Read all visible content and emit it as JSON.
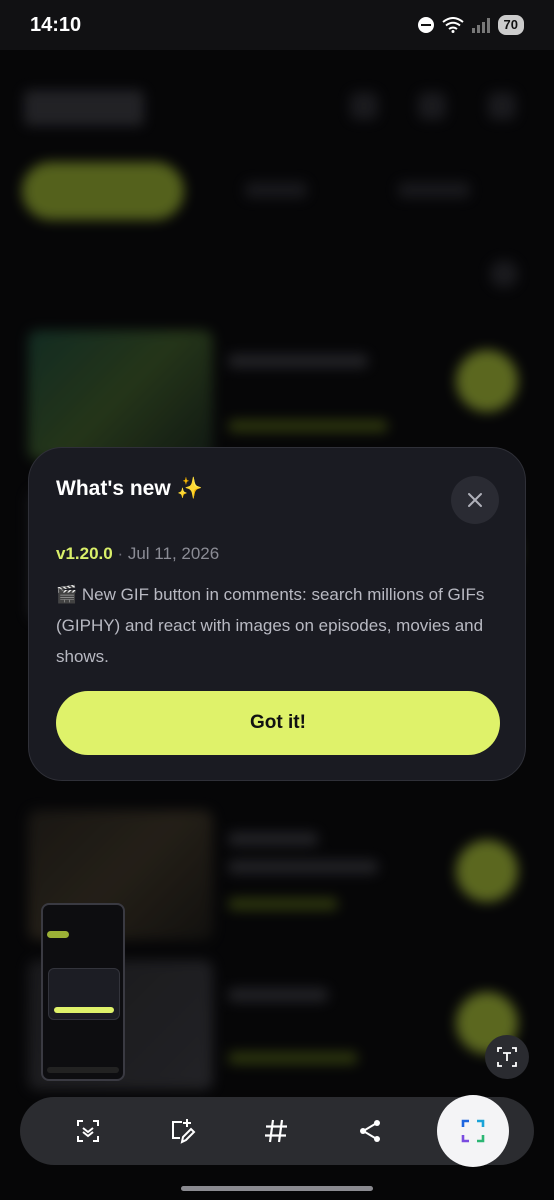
{
  "status_bar": {
    "time": "14:10",
    "battery": "70"
  },
  "dialog": {
    "title": "What's new ✨",
    "version": "v1.20.0",
    "separator": " · ",
    "date": "Jul 11, 2026",
    "description": "🎬 New GIF button in comments: search millions of GIFs (GIPHY) and react with images on episodes, movies and shows.",
    "button_label": "Got it!"
  },
  "icons": {
    "close": "close-icon",
    "text_recognize": "text-recognize-icon",
    "scroll_capture": "scroll-capture-icon",
    "edit": "edit-icon",
    "hashtag": "hashtag-icon",
    "share": "share-icon",
    "partial_capture": "partial-capture-icon"
  },
  "colors": {
    "accent": "#dff26a",
    "dialog_bg": "#1a1b22",
    "version": "#d9ef6a"
  }
}
